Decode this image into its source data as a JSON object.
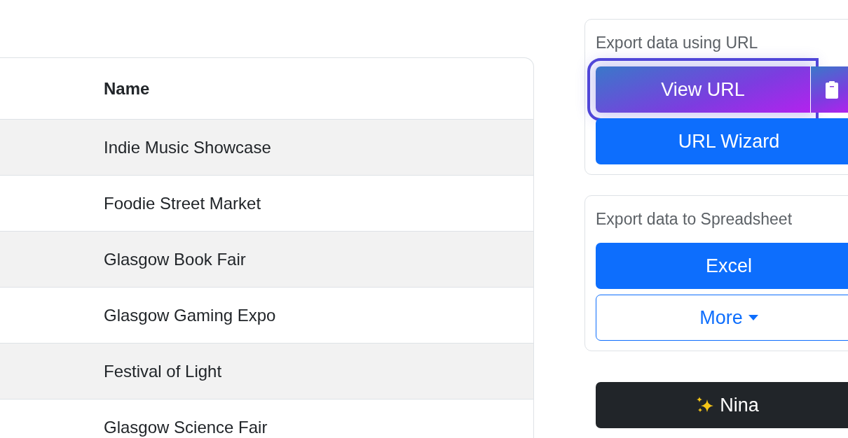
{
  "table": {
    "columns": [
      "Name"
    ],
    "rows": [
      {
        "name": "Indie Music Showcase"
      },
      {
        "name": "Foodie Street Market"
      },
      {
        "name": "Glasgow Book Fair"
      },
      {
        "name": "Glasgow Gaming Expo"
      },
      {
        "name": "Festival of Light"
      },
      {
        "name": "Glasgow Science Fair"
      }
    ]
  },
  "url_export": {
    "title": "Export data using URL",
    "view_button": {
      "label": "View URL",
      "focused": true
    },
    "wizard_button": "URL Wizard"
  },
  "spreadsheet_export": {
    "title": "Export data to Spreadsheet",
    "excel_button": "Excel",
    "more_button": "More"
  },
  "assistant_button": "Nina"
}
